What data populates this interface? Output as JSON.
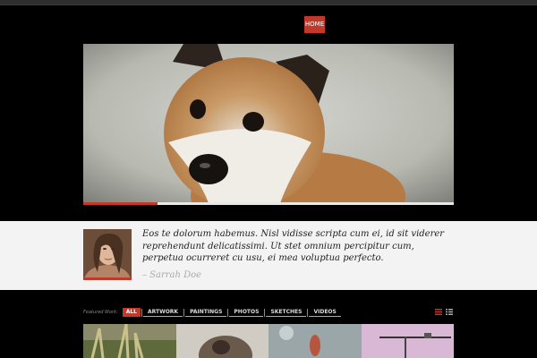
{
  "nav": {
    "home_label": "HOME"
  },
  "hero": {
    "image_alt": "shiba-inu-puppy",
    "progress_percent": 20
  },
  "testimonial": {
    "quote": "Eos te dolorum habemus. Nisl vidisse scripta cum ei, id sit viderer reprehendunt delicatissimi. Ut stet omnium percipitur cum, perpetua ocurreret cu usu, ei mea voluptua perfecto.",
    "author": "– Sarrah Doe"
  },
  "portfolio": {
    "label": "Featured Work:",
    "filters": [
      "ALL",
      "ARTWORK",
      "PAINTINGS",
      "PHOTOS",
      "SKETCHES",
      "VIDEOS"
    ],
    "active_filter": "ALL"
  },
  "colors": {
    "accent": "#c0392b",
    "background": "#000000",
    "band": "#f3f3f3"
  }
}
